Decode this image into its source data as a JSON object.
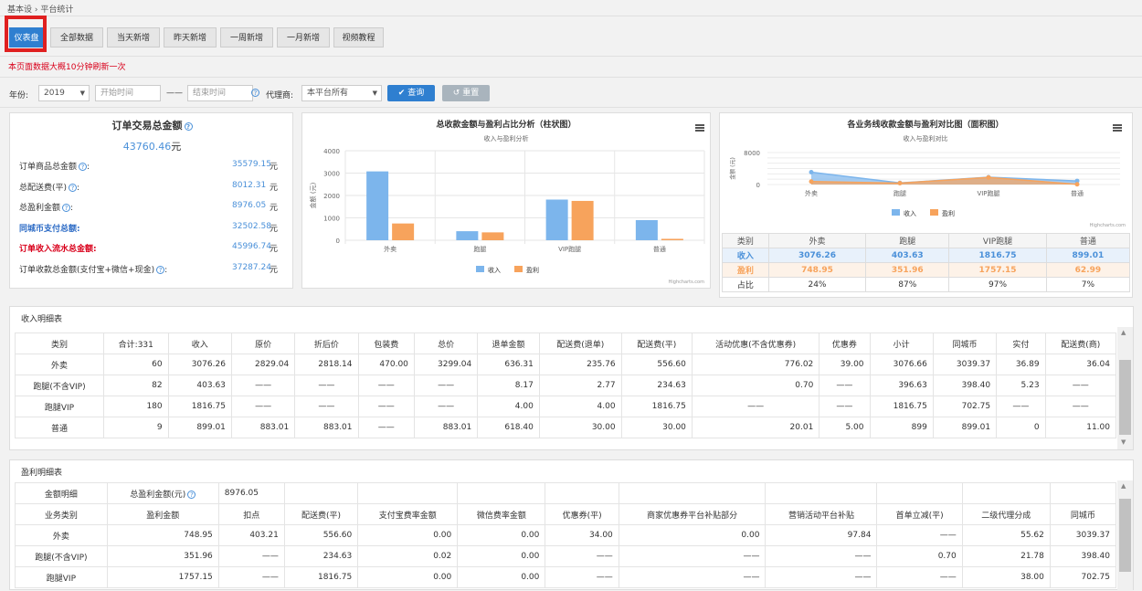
{
  "breadcrumb": {
    "root": "基本设",
    "sep": "›",
    "current": "平台统计"
  },
  "tabs": [
    "仪表盘",
    "全部数据",
    "当天新增",
    "昨天新增",
    "一周新增",
    "一月新增",
    "视频教程"
  ],
  "notice": "本页面数据大概10分钟刷新一次",
  "filter": {
    "year_label": "年份:",
    "year_value": "2019",
    "start_placeholder": "开始时间",
    "dash": "——",
    "end_placeholder": "结束时间",
    "agent_label": "代理商:",
    "agent_value": "本平台所有",
    "query_label": "查询",
    "reset_label": "重置"
  },
  "summary": {
    "title": "订单交易总金额",
    "total": "43760.46元",
    "rows": [
      {
        "label": "订单商品总金额",
        "value": "35579.15",
        "unit": "元",
        "help": true,
        "style": "normal"
      },
      {
        "label": "总配送费(平)",
        "value": "8012.31",
        "unit": "元",
        "help": true,
        "style": "normal"
      },
      {
        "label": "总盈利金额",
        "value": "8976.05",
        "unit": "元",
        "help": true,
        "style": "normal"
      },
      {
        "label": "同城币支付总额:",
        "value": "32502.58",
        "unit": "元",
        "help": false,
        "style": "blue"
      },
      {
        "label": "订单收入流水总金额:",
        "value": "45996.74",
        "unit": "元",
        "help": false,
        "style": "red"
      },
      {
        "label": "订单收款总金额(支付宝+微信+现金)",
        "value": "37287.24",
        "unit": "元",
        "help": true,
        "style": "normal"
      }
    ]
  },
  "bar_chart_data": {
    "type": "bar",
    "title": "总收款金额与盈利占比分析（柱状图）",
    "subtitle": "收入与盈利分析",
    "ylabel": "金额 (元)",
    "categories": [
      "外卖",
      "跑腿",
      "VIP跑腿",
      "普通"
    ],
    "ylim": [
      0,
      4000
    ],
    "yticks": [
      "0",
      "1000",
      "2000",
      "3000",
      "4000"
    ],
    "series": [
      {
        "name": "收入",
        "color": "#7cb5ec",
        "values": [
          3076.26,
          403.63,
          1816.75,
          899.01
        ]
      },
      {
        "name": "盈利",
        "color": "#f7a35c",
        "values": [
          748.95,
          351.96,
          1757.15,
          62.99
        ]
      }
    ],
    "credit": "Highcharts.com"
  },
  "area_chart_data": {
    "type": "area",
    "title": "各业务线收款金额与盈利对比图（面积图）",
    "subtitle": "收入与盈利对比",
    "ylabel": "金额 (元)",
    "categories": [
      "外卖",
      "跑腿",
      "VIP跑腿",
      "普通"
    ],
    "ylim": [
      0,
      8000
    ],
    "yticks": [
      "0",
      "8000"
    ],
    "series": [
      {
        "name": "收入",
        "color": "#7cb5ec",
        "values": [
          3076.26,
          403.63,
          1816.75,
          899.01
        ]
      },
      {
        "name": "盈利",
        "color": "#f7a35c",
        "values": [
          748.95,
          351.96,
          1757.15,
          62.99
        ]
      }
    ],
    "credit": "Highcharts.com"
  },
  "compare_table": {
    "headers": [
      "类别",
      "外卖",
      "跑腿",
      "VIP跑腿",
      "普通"
    ],
    "rows": [
      {
        "cells": [
          "收入",
          "3076.26",
          "403.63",
          "1816.75",
          "899.01"
        ],
        "color": "#4a90d9",
        "bg": "#e8f1fb"
      },
      {
        "cells": [
          "盈利",
          "748.95",
          "351.96",
          "1757.15",
          "62.99"
        ],
        "color": "#f7a35c",
        "bg": "#fdf2e8"
      },
      {
        "cells": [
          "占比",
          "24%",
          "87%",
          "97%",
          "7%"
        ],
        "color": "#333",
        "bg": "#fff"
      }
    ]
  },
  "income_table": {
    "title": "收入明细表",
    "headers": [
      "类别",
      "合计:331",
      "收入",
      "原价",
      "折后价",
      "包装费",
      "总价",
      "退单金额",
      "配送费(退单)",
      "配送费(平)",
      "活动优惠(不含优惠券)",
      "优惠券",
      "小计",
      "同城币",
      "实付",
      "配送费(商)"
    ],
    "rows": [
      [
        "外卖",
        "60",
        "3076.26",
        "2829.04",
        "2818.14",
        "470.00",
        "3299.04",
        "636.31",
        "235.76",
        "556.60",
        "776.02",
        "39.00",
        "3076.66",
        "3039.37",
        "36.89",
        "36.04"
      ],
      [
        "跑腿(不含VIP)",
        "82",
        "403.63",
        "——",
        "——",
        "——",
        "——",
        "8.17",
        "2.77",
        "234.63",
        "0.70",
        "——",
        "396.63",
        "398.40",
        "5.23",
        "——"
      ],
      [
        "跑腿VIP",
        "180",
        "1816.75",
        "——",
        "——",
        "——",
        "——",
        "4.00",
        "4.00",
        "1816.75",
        "——",
        "——",
        "1816.75",
        "702.75",
        "——",
        "——"
      ],
      [
        "普通",
        "9",
        "899.01",
        "883.01",
        "883.01",
        "——",
        "883.01",
        "618.40",
        "30.00",
        "30.00",
        "20.01",
        "5.00",
        "899",
        "899.01",
        "0",
        "11.00"
      ]
    ]
  },
  "profit_table": {
    "title": "盈利明细表",
    "top": [
      "金额明细",
      "总盈利金额(元)",
      "8976.05"
    ],
    "headers": [
      "业务类别",
      "盈利金额",
      "扣点",
      "配送费(平)",
      "支付宝费率金额",
      "微信费率金额",
      "优惠券(平)",
      "商家优惠券平台补贴部分",
      "营销活动平台补贴",
      "首单立减(平)",
      "二级代理分成",
      "同城币"
    ],
    "rows": [
      [
        "外卖",
        "748.95",
        "403.21",
        "556.60",
        "0.00",
        "0.00",
        "34.00",
        "0.00",
        "97.84",
        "——",
        "55.62",
        "3039.37"
      ],
      [
        "跑腿(不含VIP)",
        "351.96",
        "——",
        "234.63",
        "0.02",
        "0.00",
        "——",
        "——",
        "——",
        "0.70",
        "21.78",
        "398.40"
      ],
      [
        "跑腿VIP",
        "1757.15",
        "——",
        "1816.75",
        "0.00",
        "0.00",
        "——",
        "——",
        "——",
        "——",
        "38.00",
        "702.75"
      ]
    ]
  }
}
